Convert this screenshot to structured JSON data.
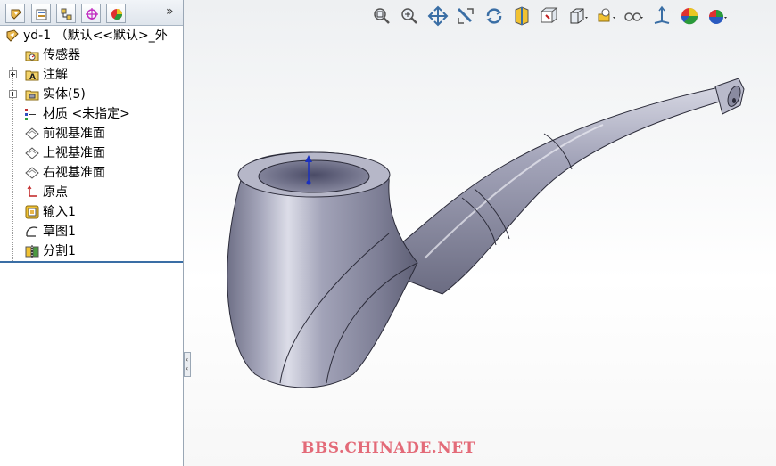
{
  "tree": {
    "root": "yd-1 （默认<<默认>_外",
    "items": [
      {
        "label": "传感器",
        "icon": "sensor-folder-icon",
        "expandable": false
      },
      {
        "label": "注解",
        "icon": "annotation-folder-icon",
        "expandable": true
      },
      {
        "label": "实体(5)",
        "icon": "solid-bodies-folder-icon",
        "expandable": true
      },
      {
        "label": "材质 <未指定>",
        "icon": "material-icon",
        "expandable": false
      },
      {
        "label": "前视基准面",
        "icon": "plane-icon",
        "expandable": false
      },
      {
        "label": "上视基准面",
        "icon": "plane-icon",
        "expandable": false
      },
      {
        "label": "右视基准面",
        "icon": "plane-icon",
        "expandable": false
      },
      {
        "label": "原点",
        "icon": "origin-icon",
        "expandable": false
      },
      {
        "label": "输入1",
        "icon": "import-feature-icon",
        "expandable": false
      },
      {
        "label": "草图1",
        "icon": "sketch-icon",
        "expandable": false
      },
      {
        "label": "分割1",
        "icon": "split-feature-icon",
        "expandable": false
      }
    ]
  },
  "panel_tabs": {
    "expand_label": "»",
    "tabs": [
      "feature-manager-tab",
      "property-manager-tab",
      "configuration-manager-tab",
      "dimxpert-tab",
      "display-manager-tab"
    ]
  },
  "viewport": {
    "watermark": "BBS.CHINADE.NET",
    "toolbar": [
      "zoom-to-fit-icon",
      "zoom-to-area-icon",
      "pan-icon",
      "previous-view-icon",
      "rotate-icon",
      "section-view-icon",
      "view-orientation-icon",
      "display-style-icon",
      "hide-show-icon",
      "edit-appearance-icon",
      "apply-scene-icon",
      "view-settings-icon",
      "reference-triad-icon",
      "realview-icon",
      "scene-icon"
    ]
  },
  "colors": {
    "accent": "#3a6ea5",
    "model_body": "#9a9aae",
    "watermark": "#e36a78"
  }
}
